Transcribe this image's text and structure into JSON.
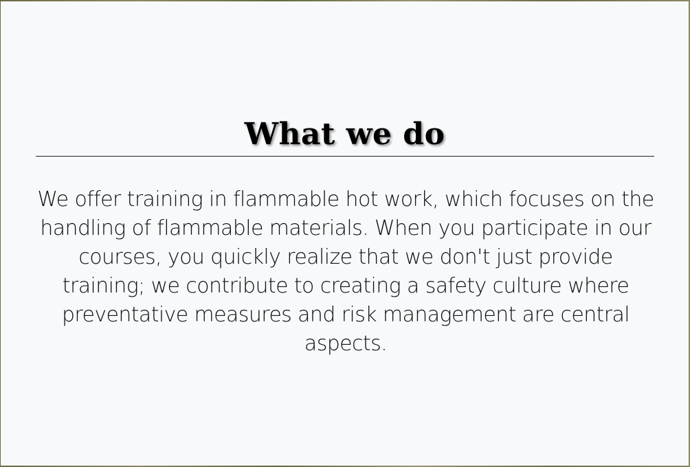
{
  "section": {
    "title": "What we do",
    "description": "We offer training in flammable hot work, which focuses on the handling of flammable materials. When you participate in our courses, you quickly realize that we don't just provide training; we contribute to creating a safety culture where preventative measures and risk management are central aspects."
  },
  "colors": {
    "card_background": "#f7f9fb",
    "text": "#111111",
    "divider": "#222222"
  }
}
